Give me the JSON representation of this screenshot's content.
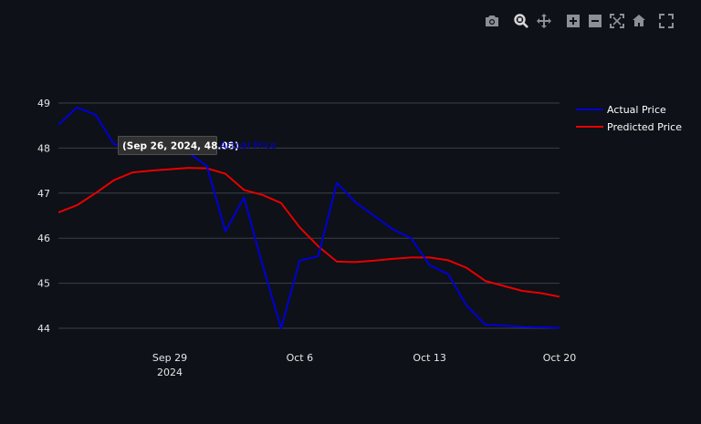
{
  "modebar": {
    "icons": [
      "camera-icon",
      "zoom-icon",
      "pan-icon",
      "zoom-in-icon",
      "zoom-out-icon",
      "autoscale-icon",
      "home-icon",
      "fullscreen-icon"
    ]
  },
  "colors": {
    "background": "#0e1117",
    "grid": "#3a3f4b",
    "actual": "#0000d6",
    "predicted": "#e80000",
    "tick": "#e6e6e6",
    "modebar_icon": "#8c8f96"
  },
  "hover": {
    "label": "(Sep 26, 2024, 48.08)",
    "series_name": "Actual Price"
  },
  "chart_data": {
    "type": "line",
    "title": "",
    "xlabel": "",
    "ylabel": "",
    "ylim": [
      44,
      49
    ],
    "grid": true,
    "legend_position": "top-right",
    "x_ticks": [
      {
        "date": "2024-09-29",
        "label": "Sep 29",
        "sublabel": "2024"
      },
      {
        "date": "2024-10-06",
        "label": "Oct 6",
        "sublabel": ""
      },
      {
        "date": "2024-10-13",
        "label": "Oct 13",
        "sublabel": ""
      },
      {
        "date": "2024-10-20",
        "label": "Oct 20",
        "sublabel": ""
      }
    ],
    "y_ticks": [
      44,
      45,
      46,
      47,
      48,
      49
    ],
    "series": [
      {
        "name": "Actual Price",
        "x": [
          "2024-09-23",
          "2024-09-24",
          "2024-09-25",
          "2024-09-26",
          "2024-09-27",
          "2024-09-28",
          "2024-09-29",
          "2024-09-30",
          "2024-10-01",
          "2024-10-02",
          "2024-10-03",
          "2024-10-04",
          "2024-10-05",
          "2024-10-06",
          "2024-10-07",
          "2024-10-08",
          "2024-10-09",
          "2024-10-10",
          "2024-10-11",
          "2024-10-12",
          "2024-10-13",
          "2024-10-14",
          "2024-10-15",
          "2024-10-16",
          "2024-10-17",
          "2024-10-18",
          "2024-10-19",
          "2024-10-20"
        ],
        "values": [
          48.52,
          48.9,
          48.74,
          48.08,
          48.05,
          48.03,
          47.95,
          47.9,
          47.6,
          46.15,
          46.9,
          45.4,
          44.0,
          45.5,
          45.6,
          47.23,
          46.8,
          46.5,
          46.2,
          46.0,
          45.4,
          45.2,
          44.5,
          44.08,
          44.06,
          44.03,
          44.02,
          44.01
        ],
        "color": "#0000d6"
      },
      {
        "name": "Predicted Price",
        "x": [
          "2024-09-23",
          "2024-09-24",
          "2024-09-25",
          "2024-09-26",
          "2024-09-27",
          "2024-09-28",
          "2024-09-29",
          "2024-09-30",
          "2024-10-01",
          "2024-10-02",
          "2024-10-03",
          "2024-10-04",
          "2024-10-05",
          "2024-10-06",
          "2024-10-07",
          "2024-10-08",
          "2024-10-09",
          "2024-10-10",
          "2024-10-11",
          "2024-10-12",
          "2024-10-13",
          "2024-10-14",
          "2024-10-15",
          "2024-10-16",
          "2024-10-17",
          "2024-10-18",
          "2024-10-19",
          "2024-10-20"
        ],
        "values": [
          46.57,
          46.73,
          47.0,
          47.29,
          47.46,
          47.5,
          47.53,
          47.56,
          47.55,
          47.43,
          47.07,
          46.96,
          46.78,
          46.24,
          45.82,
          45.48,
          45.47,
          45.5,
          45.54,
          45.57,
          45.57,
          45.51,
          45.34,
          45.05,
          44.94,
          44.83,
          44.78,
          44.7
        ],
        "color": "#e80000"
      }
    ]
  }
}
